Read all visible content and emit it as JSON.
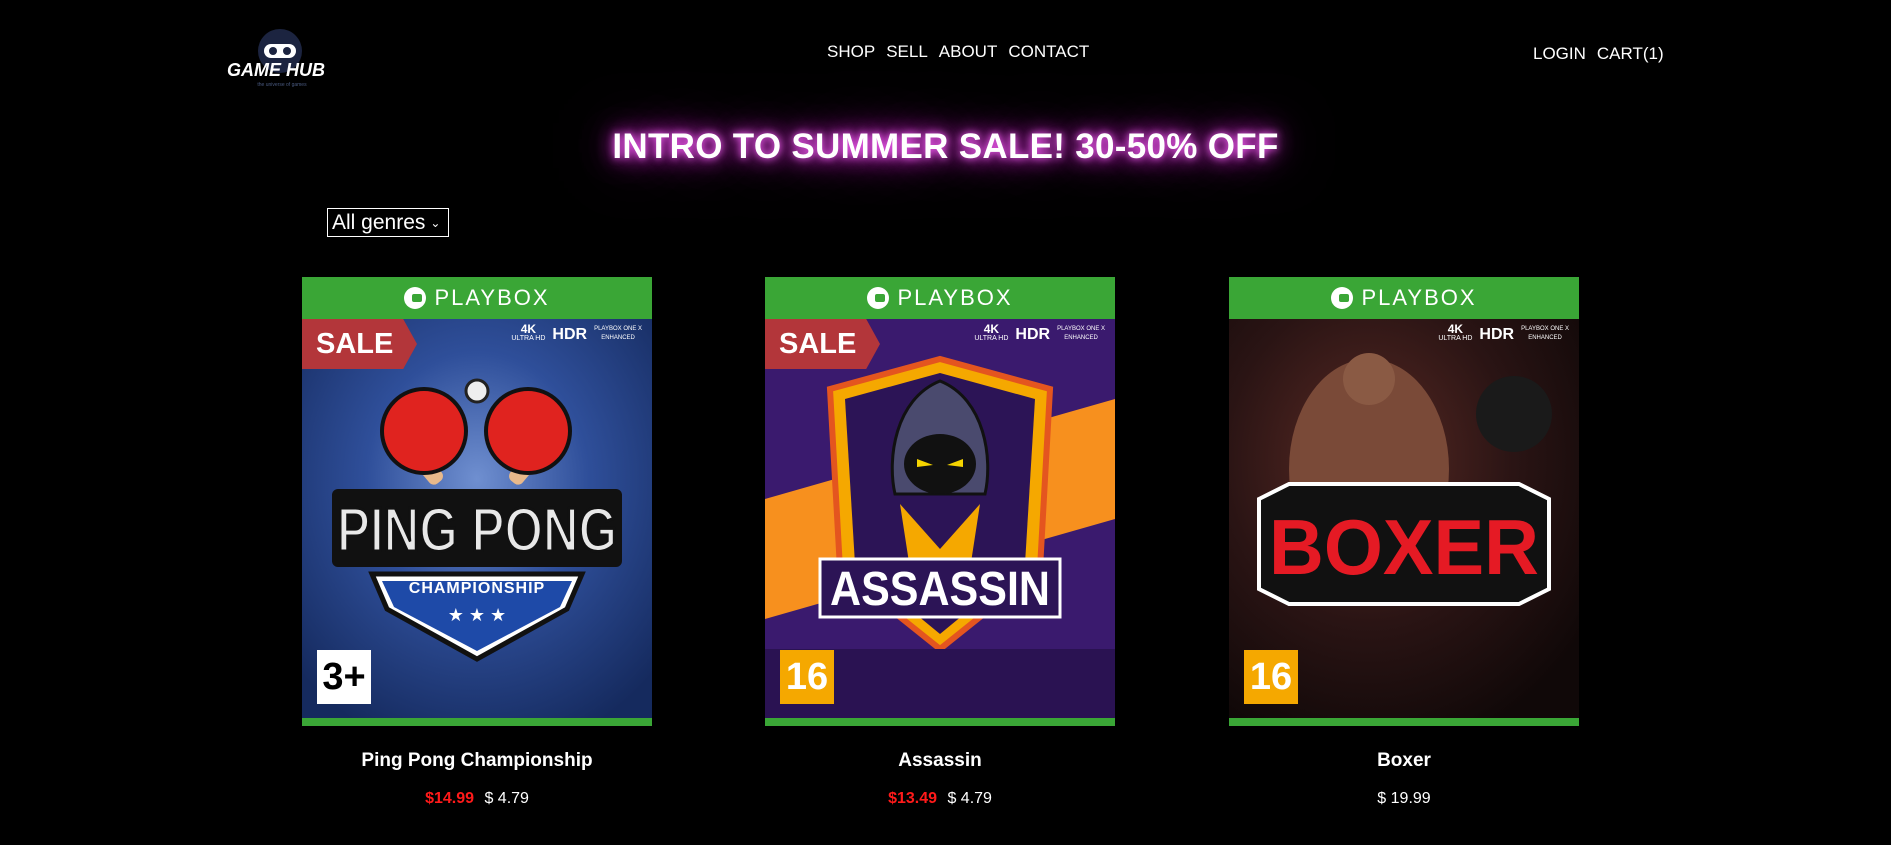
{
  "logo": {
    "text": "GAME HUB",
    "tagline": "the universe of games"
  },
  "nav": {
    "items": [
      "SHOP",
      "SELL",
      "ABOUT",
      "CONTACT"
    ]
  },
  "account": {
    "login": "LOGIN",
    "cart": "CART(1)"
  },
  "banner": {
    "text": "INTRO TO SUMMER SALE! 30-50% OFF"
  },
  "filter": {
    "selected": "All genres"
  },
  "products": [
    {
      "title": "Ping Pong Championship",
      "old_price": "$14.99",
      "price": "$ 4.79",
      "platform": "PLAYBOX",
      "sale_badge": "SALE",
      "rating": "3+",
      "art_title": "PING PONG",
      "art_subtitle": "CHAMPIONSHIP"
    },
    {
      "title": "Assassin",
      "old_price": "$13.49",
      "price": "$ 4.79",
      "platform": "PLAYBOX",
      "sale_badge": "SALE",
      "rating": "16",
      "art_title": "ASSASSIN"
    },
    {
      "title": "Boxer",
      "price": "$ 19.99",
      "platform": "PLAYBOX",
      "rating": "16",
      "art_title": "BOXER"
    }
  ],
  "cover_specs": {
    "k4": "4K",
    "uhd": "ULTRA HD",
    "hdr": "HDR",
    "enhanced_1": "PLAYBOX ONE X",
    "enhanced_2": "ENHANCED"
  },
  "colors": {
    "platform_green": "#3aa636",
    "sale_red": "#b3363a",
    "old_price_red": "#ff1a1a",
    "banner_glow": "#e040e0",
    "rating_orange": "#f5a800"
  }
}
